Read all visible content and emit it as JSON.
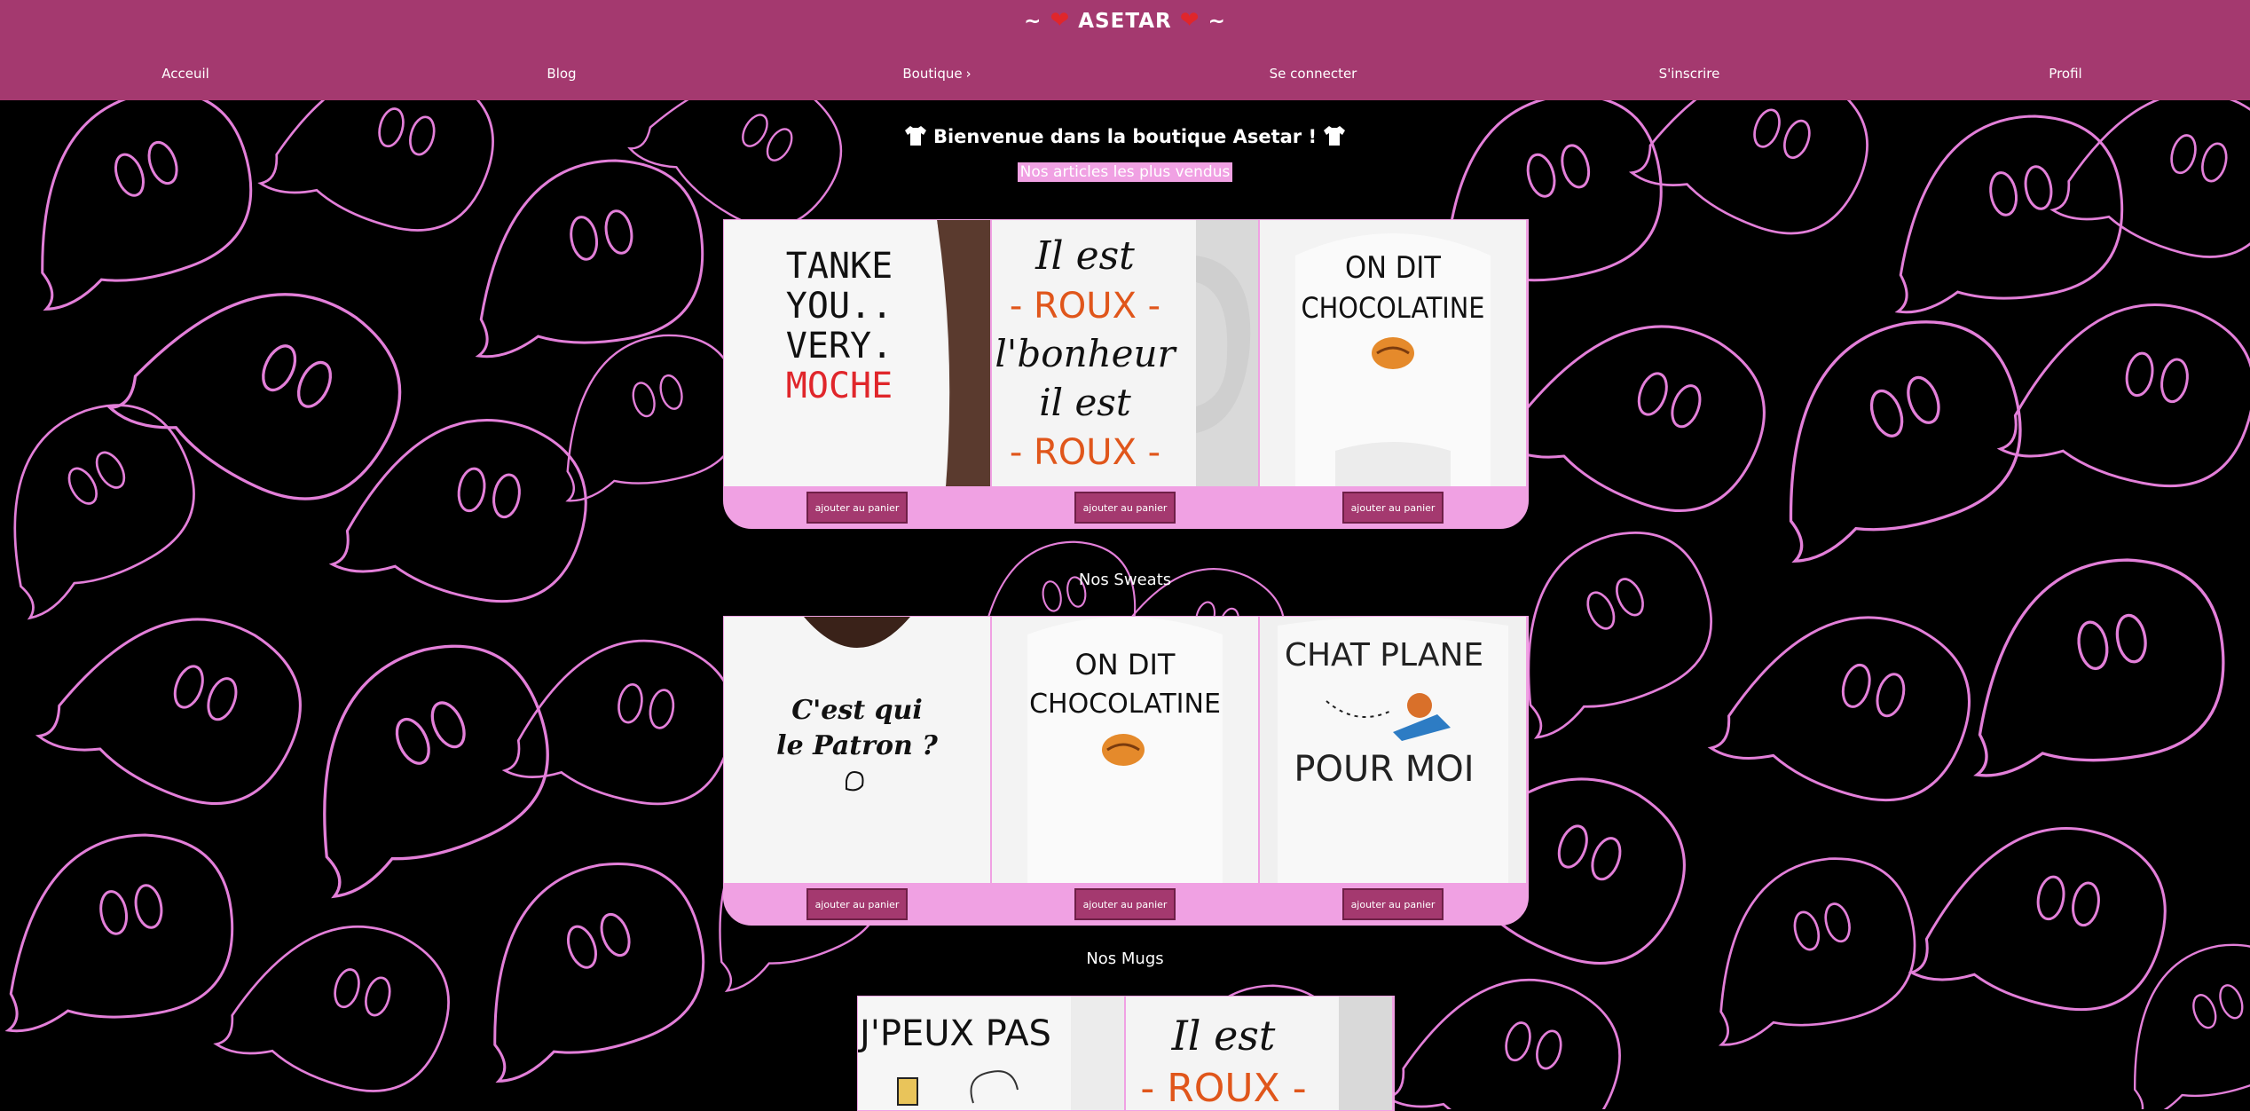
{
  "header": {
    "title_prefix": "~",
    "title": "ASETAR",
    "title_suffix": "~",
    "nav": [
      {
        "label": "Acceuil"
      },
      {
        "label": "Blog"
      },
      {
        "label": "Boutique"
      },
      {
        "label": "Se connecter"
      },
      {
        "label": "S'inscrire"
      },
      {
        "label": "Profil"
      }
    ]
  },
  "main": {
    "welcome": "Bienvenue dans la boutique Asetar !",
    "bestsellers_title": "Nos articles les plus vendus",
    "sweats_title": "Nos Sweats",
    "mugs_title": "Nos Mugs",
    "add_to_cart_label": "ajouter au panier",
    "bestsellers": [
      {
        "line1": "TANKE",
        "line2": "YOU..",
        "line3": "VERY.",
        "line4": "MOCHE"
      },
      {
        "line1": "Il est",
        "line2": "- ROUX -",
        "line3": "l'bonheur",
        "line4": "il est",
        "line5": "- ROUX -"
      },
      {
        "line1": "ON DIT",
        "line2": "CHOCOLATINE"
      }
    ],
    "sweats": [
      {
        "line1": "C'est qui",
        "line2": "le Patron ?"
      },
      {
        "line1": "ON DIT",
        "line2": "CHOCOLATINE"
      },
      {
        "line1": "CHAT PLANE",
        "line2": "POUR MOI"
      }
    ],
    "mugs": [
      {
        "line1": "J'PEUX PAS"
      },
      {
        "line1": "Il est",
        "line2": "- ROUX -"
      }
    ]
  },
  "colors": {
    "header_bg": "#a4396f",
    "accent_pink": "#f0a1e3",
    "ghost_outline": "#e37fd9",
    "button_bg": "#a4396f",
    "product_red": "#e0262b",
    "product_orange": "#e0561b"
  }
}
